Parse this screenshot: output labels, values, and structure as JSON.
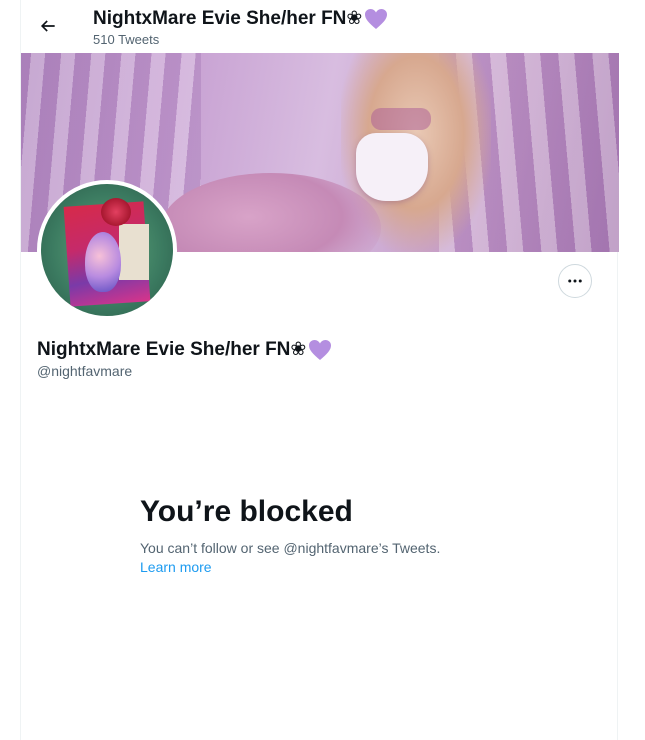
{
  "header": {
    "title": "NightxMare Evie She/her FN❀",
    "tweet_count": "510 Tweets"
  },
  "profile": {
    "display_name": "NightxMare Evie She/her FN❀",
    "handle": "@nightfavmare"
  },
  "blocked": {
    "title": "You’re blocked",
    "message": "You can’t follow or see @nightfavmare’s Tweets.",
    "learn_more": "Learn more"
  },
  "colors": {
    "accent": "#1d9bf0",
    "secondary_text": "#536471",
    "heart": "#b48ee0"
  },
  "icons": {
    "back": "arrow-left-icon",
    "more": "more-horizontal-icon",
    "heart": "purple-heart-icon"
  }
}
